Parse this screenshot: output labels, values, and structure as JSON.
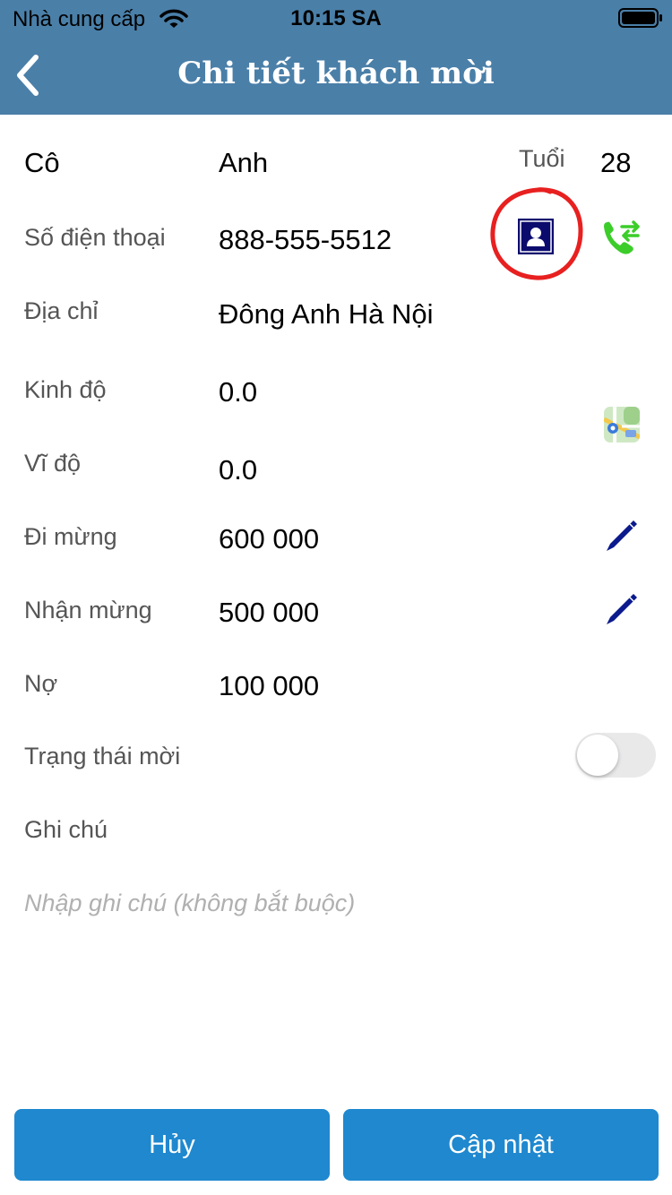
{
  "status_bar": {
    "carrier": "Nhà cung cấp",
    "time": "10:15 SA"
  },
  "header": {
    "title": "Chi tiết khách mời",
    "color": "#4a7fa8"
  },
  "guest": {
    "salutation": "Cô",
    "name": "Anh",
    "age_label": "Tuổi",
    "age": "28",
    "phone_label": "Số điện thoại",
    "phone": "888-555-5512",
    "address_label": "Địa chỉ",
    "address": "Đông Anh Hà Nội",
    "longitude_label": "Kinh độ",
    "longitude": "0.0",
    "latitude_label": "Vĩ độ",
    "latitude": "0.0",
    "gift_given_label": "Đi mừng",
    "gift_given": "600 000",
    "gift_received_label": "Nhận mừng",
    "gift_received": "500 000",
    "debt_label": "Nợ",
    "debt": "100 000",
    "invite_status_label": "Trạng thái mời",
    "invite_status_on": false,
    "note_label": "Ghi chú",
    "note_placeholder": "Nhập ghi chú (không bắt buộc)",
    "note_value": ""
  },
  "icons": {
    "contact": "contact-card-icon",
    "call": "phone-forward-icon",
    "map": "map-icon",
    "edit": "pencil-icon"
  },
  "buttons": {
    "cancel": "Hủy",
    "update": "Cập nhật",
    "color": "#1f88cf"
  }
}
